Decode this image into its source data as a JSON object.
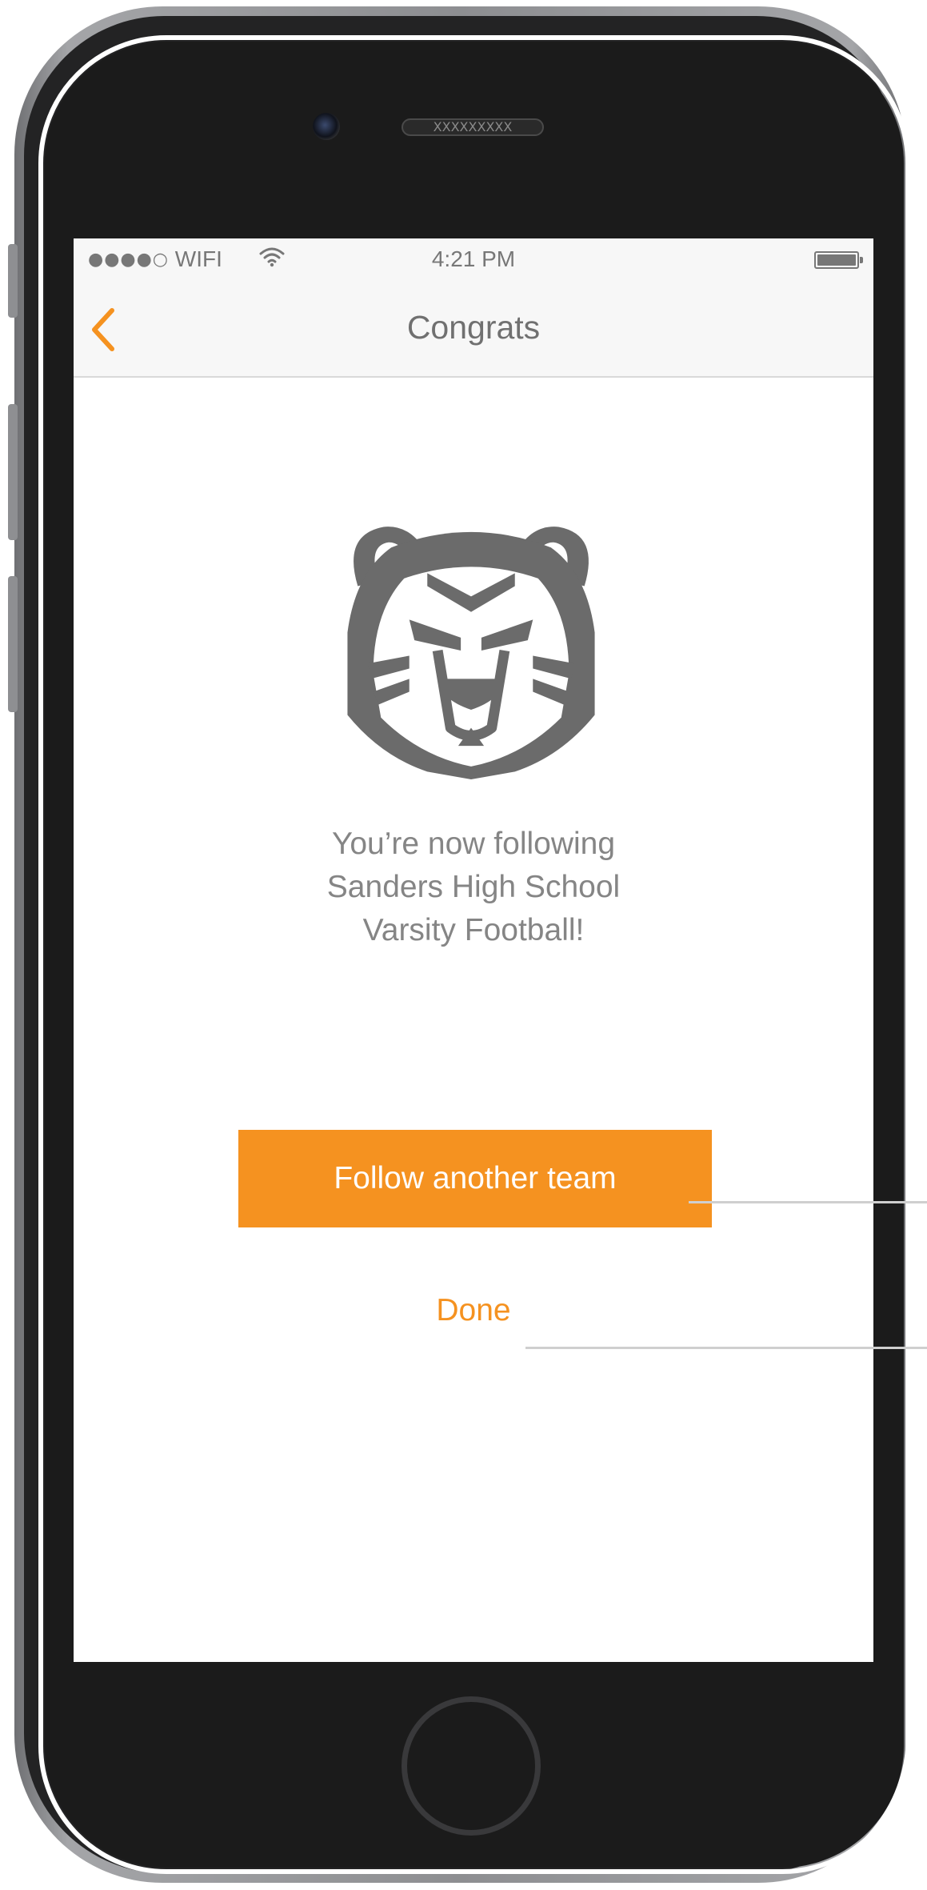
{
  "status_bar": {
    "signal": "●●●●○",
    "carrier": "WIFI",
    "time": "4:21 PM"
  },
  "nav": {
    "title": "Congrats",
    "back_icon": "chevron-left-icon"
  },
  "device": {
    "speaker_text": "XXXXXXXXX"
  },
  "confirmation": {
    "mascot_icon": "tiger-head-icon",
    "lines": [
      "You’re now following",
      "Sanders High School",
      "Varsity Football!"
    ]
  },
  "actions": {
    "follow_another": "Follow another team",
    "done": "Done"
  },
  "colors": {
    "accent": "#f59220",
    "text_gray": "#858585",
    "icon_gray": "#6b6b6b"
  }
}
